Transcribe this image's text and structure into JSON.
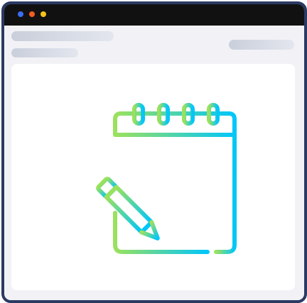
{
  "window": {
    "title_dots": [
      "blue",
      "orange",
      "yellow"
    ]
  },
  "header": {
    "placeholders": [
      "text-line-1",
      "text-line-2",
      "text-line-right"
    ]
  },
  "content": {
    "icon": "notepad-with-pencil-icon",
    "icon_colors": [
      "#9BE15D",
      "#00C6FB"
    ]
  }
}
